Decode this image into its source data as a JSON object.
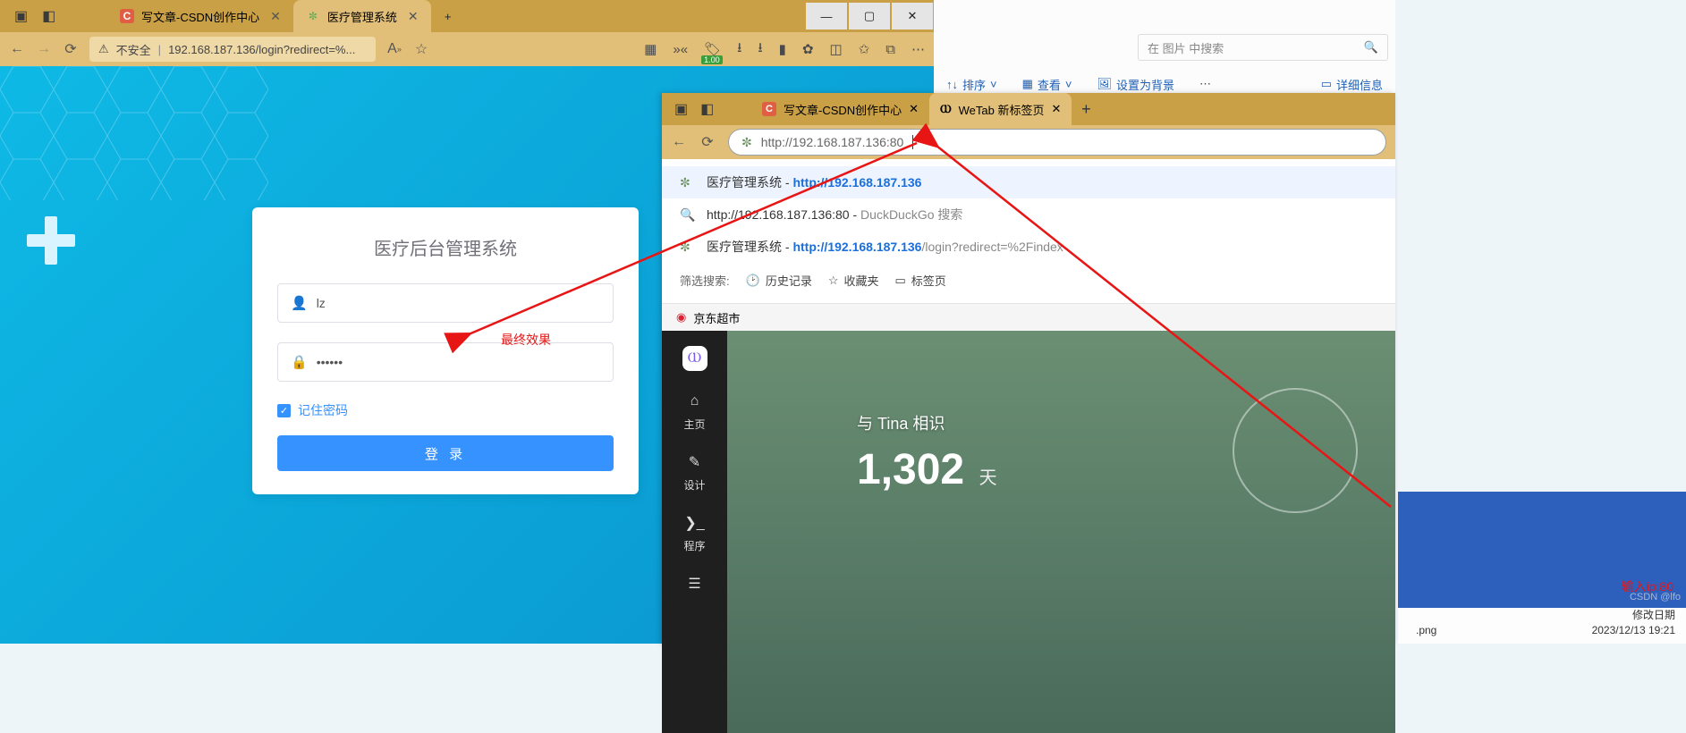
{
  "left_window": {
    "tabs": [
      {
        "label": "写文章-CSDN创作中心",
        "favicon": "C"
      },
      {
        "label": "医疗管理系统",
        "favicon": "leaf"
      }
    ],
    "url_display": "192.168.187.136/login?redirect=%...",
    "url_prefix": "不安全",
    "reader_badge": "1.00",
    "login_panel": {
      "title": "医疗后台管理系统",
      "username_value": "lz",
      "password_value": "••••••",
      "remember_label": "记住密码",
      "submit_label": "登 录"
    },
    "arrow_label": "最终效果"
  },
  "right_window": {
    "tabs": [
      {
        "label": "写文章-CSDN创作中心",
        "favicon": "C"
      },
      {
        "label": "WeTab 新标签页",
        "favicon": "W"
      }
    ],
    "url_input": "http://192.168.187.136:80",
    "suggestions": [
      {
        "icon": "leaf",
        "title": "医疗管理系统",
        "sep": " - ",
        "url": "http://192.168.187.136",
        "tail": ""
      },
      {
        "icon": "search",
        "title": "http://192.168.187.136:80",
        "sep": " - ",
        "url": "",
        "tail": "DuckDuckGo 搜索"
      },
      {
        "icon": "leaf",
        "title": "医疗管理系统",
        "sep": " - ",
        "url": "http://192.168.187.136",
        "tail": "/login?redirect=%2Findex"
      }
    ],
    "filter": {
      "label": "筛选搜索:",
      "history": "历史记录",
      "fav": "收藏夹",
      "tabs": "标签页"
    },
    "quickbar_item": "京东超市",
    "sidebar": [
      {
        "icon": "app",
        "label": ""
      },
      {
        "icon": "home",
        "label": "主页"
      },
      {
        "icon": "design",
        "label": "设计"
      },
      {
        "icon": "code",
        "label": "程序"
      },
      {
        "icon": "more",
        "label": ""
      }
    ],
    "widget": {
      "title": "与 Tina 相识",
      "number": "1,302",
      "unit": "天"
    }
  },
  "top_right": {
    "search_placeholder": "在 图片 中搜索",
    "tools": {
      "sort": "排序",
      "view": "查看",
      "wallpaper": "设置为背景",
      "details": "详细信息"
    }
  },
  "bottom_right": {
    "arrow_label": "输入ip:80",
    "png_ext": ".png",
    "date_label": "修改日期",
    "date_value": "2023/12/13 19:21"
  },
  "watermark": "CSDN @lfo"
}
